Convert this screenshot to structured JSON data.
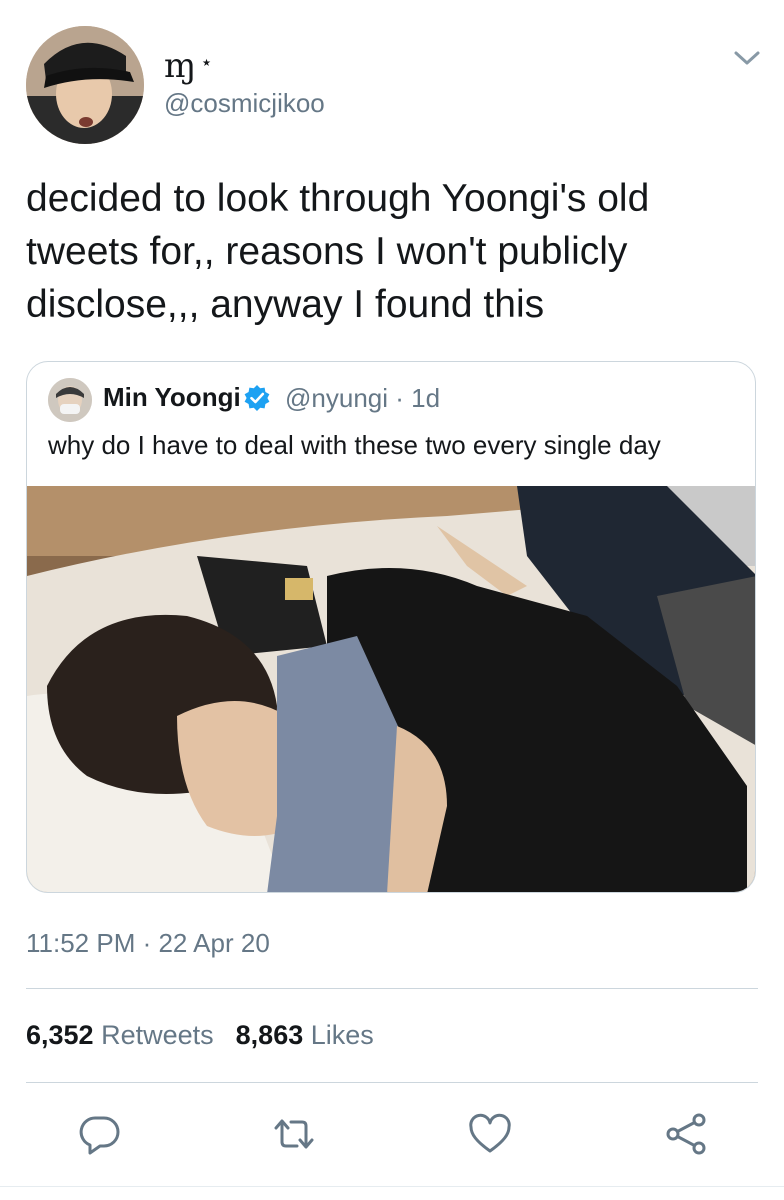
{
  "author": {
    "display_name": "ɱ",
    "display_star": "⋆",
    "handle": "@cosmicjikoo",
    "avatar_icon": "avatar-photo"
  },
  "tweet": {
    "text": "decided to look through Yoongi's old\ntweets for,, reasons I won't publicly\ndisclose,,, anyway I found this"
  },
  "quoted_tweet": {
    "name": "Min Yoongi",
    "handle": "@nyungi",
    "separator": "·",
    "age": "1d",
    "text": "why do I have to deal with these two every single day",
    "verified": true
  },
  "timestamp": "11:52 PM · 22 Apr 20",
  "stats": {
    "retweets_count": "6,352",
    "retweets_label": "Retweets",
    "likes_count": "8,863",
    "likes_label": "Likes"
  },
  "actions": [
    "reply-icon",
    "retweet-icon",
    "like-icon",
    "share-icon"
  ],
  "colors": {
    "text": "#14171a",
    "muted": "#657786",
    "border": "#ccd6dd",
    "verified": "#1da1f2"
  }
}
